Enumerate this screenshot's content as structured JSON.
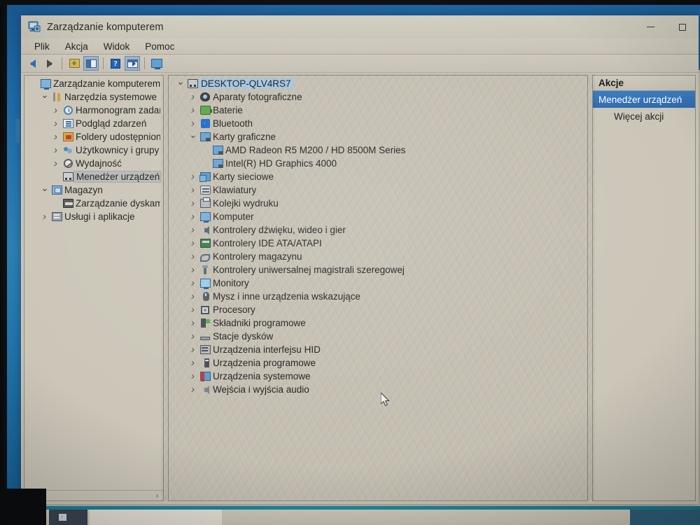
{
  "window": {
    "title": "Zarządzanie komputerem",
    "title_icon": "computer-management-icon",
    "controls": {
      "minimize": "minimize-icon",
      "maximize": "maximize-icon"
    }
  },
  "menubar": {
    "items": [
      {
        "label": "Plik"
      },
      {
        "label": "Akcja"
      },
      {
        "label": "Widok"
      },
      {
        "label": "Pomoc"
      }
    ]
  },
  "toolbar": {
    "buttons": [
      {
        "name": "back-arrow-icon"
      },
      {
        "name": "forward-arrow-icon"
      },
      {
        "name": "up-folder-icon"
      },
      {
        "name": "show-hide-console-tree-icon"
      },
      {
        "name": "help-icon"
      },
      {
        "name": "properties-icon"
      },
      {
        "name": "display-icon"
      }
    ]
  },
  "left_tree": {
    "nodes": [
      {
        "label": "Zarządzanie komputerem (loka",
        "indent": 0,
        "twisty": "none",
        "icon": "computer-icon",
        "state": "none"
      },
      {
        "label": "Narzędzia systemowe",
        "indent": 1,
        "twisty": "open",
        "icon": "system-tools-icon",
        "state": "none"
      },
      {
        "label": "Harmonogram zadań",
        "indent": 2,
        "twisty": "closed",
        "icon": "task-scheduler-icon",
        "state": "none"
      },
      {
        "label": "Podgląd zdarzeń",
        "indent": 2,
        "twisty": "closed",
        "icon": "event-viewer-icon",
        "state": "none"
      },
      {
        "label": "Foldery udostępnione",
        "indent": 2,
        "twisty": "closed",
        "icon": "shared-folders-icon",
        "state": "none"
      },
      {
        "label": "Użytkownicy i grupy lok",
        "indent": 2,
        "twisty": "closed",
        "icon": "users-groups-icon",
        "state": "none"
      },
      {
        "label": "Wydajność",
        "indent": 2,
        "twisty": "closed",
        "icon": "performance-icon",
        "state": "none"
      },
      {
        "label": "Menedżer urządzeń",
        "indent": 2,
        "twisty": "none",
        "icon": "device-manager-icon",
        "state": "selected-soft"
      },
      {
        "label": "Magazyn",
        "indent": 1,
        "twisty": "open",
        "icon": "storage-icon",
        "state": "none"
      },
      {
        "label": "Zarządzanie dyskami",
        "indent": 2,
        "twisty": "none",
        "icon": "disk-management-icon",
        "state": "none"
      },
      {
        "label": "Usługi i aplikacje",
        "indent": 1,
        "twisty": "closed",
        "icon": "services-applications-icon",
        "state": "none"
      }
    ],
    "hscroll": {
      "left_arrow": "‹",
      "right_arrow": "›"
    }
  },
  "device_tree": {
    "nodes": [
      {
        "label": "DESKTOP-QLV4RS7",
        "indent": 0,
        "twisty": "open",
        "icon": "computer-node-icon",
        "state": "selected-blue"
      },
      {
        "label": "Aparaty fotograficzne",
        "indent": 1,
        "twisty": "closed",
        "icon": "camera-icon",
        "state": "none"
      },
      {
        "label": "Baterie",
        "indent": 1,
        "twisty": "closed",
        "icon": "battery-icon",
        "state": "none"
      },
      {
        "label": "Bluetooth",
        "indent": 1,
        "twisty": "closed",
        "icon": "bluetooth-icon",
        "state": "none"
      },
      {
        "label": "Karty graficzne",
        "indent": 1,
        "twisty": "open",
        "icon": "display-adapter-icon",
        "state": "none"
      },
      {
        "label": "AMD Radeon R5 M200 / HD 8500M Series",
        "indent": 2,
        "twisty": "none",
        "icon": "display-adapter-icon",
        "state": "none"
      },
      {
        "label": "Intel(R) HD Graphics 4000",
        "indent": 2,
        "twisty": "none",
        "icon": "display-adapter-icon",
        "state": "none"
      },
      {
        "label": "Karty sieciowe",
        "indent": 1,
        "twisty": "closed",
        "icon": "network-adapter-icon",
        "state": "none"
      },
      {
        "label": "Klawiatury",
        "indent": 1,
        "twisty": "closed",
        "icon": "keyboard-icon",
        "state": "none"
      },
      {
        "label": "Kolejki wydruku",
        "indent": 1,
        "twisty": "closed",
        "icon": "print-queue-icon",
        "state": "none"
      },
      {
        "label": "Komputer",
        "indent": 1,
        "twisty": "closed",
        "icon": "computer-icon",
        "state": "none"
      },
      {
        "label": "Kontrolery dźwięku, wideo i gier",
        "indent": 1,
        "twisty": "closed",
        "icon": "sound-controller-icon",
        "state": "none"
      },
      {
        "label": "Kontrolery IDE ATA/ATAPI",
        "indent": 1,
        "twisty": "closed",
        "icon": "ide-controller-icon",
        "state": "none"
      },
      {
        "label": "Kontrolery magazynu",
        "indent": 1,
        "twisty": "closed",
        "icon": "storage-controller-icon",
        "state": "none"
      },
      {
        "label": "Kontrolery uniwersalnej magistrali szeregowej",
        "indent": 1,
        "twisty": "closed",
        "icon": "usb-controller-icon",
        "state": "none"
      },
      {
        "label": "Monitory",
        "indent": 1,
        "twisty": "closed",
        "icon": "monitor-icon",
        "state": "none"
      },
      {
        "label": "Mysz i inne urządzenia wskazujące",
        "indent": 1,
        "twisty": "closed",
        "icon": "mouse-icon",
        "state": "none"
      },
      {
        "label": "Procesory",
        "indent": 1,
        "twisty": "closed",
        "icon": "processor-icon",
        "state": "none"
      },
      {
        "label": "Składniki programowe",
        "indent": 1,
        "twisty": "closed",
        "icon": "software-components-icon",
        "state": "none"
      },
      {
        "label": "Stacje dysków",
        "indent": 1,
        "twisty": "closed",
        "icon": "disk-drive-icon",
        "state": "none"
      },
      {
        "label": "Urządzenia interfejsu HID",
        "indent": 1,
        "twisty": "closed",
        "icon": "hid-device-icon",
        "state": "none"
      },
      {
        "label": "Urządzenia programowe",
        "indent": 1,
        "twisty": "closed",
        "icon": "software-device-icon",
        "state": "none"
      },
      {
        "label": "Urządzenia systemowe",
        "indent": 1,
        "twisty": "closed",
        "icon": "system-device-icon",
        "state": "none"
      },
      {
        "label": "Wejścia i wyjścia audio",
        "indent": 1,
        "twisty": "closed",
        "icon": "audio-io-icon",
        "state": "none"
      }
    ]
  },
  "actions_pane": {
    "header": "Akcje",
    "selected_item": "Menedżer urządzeń",
    "items": [
      {
        "label": "Więcej akcji"
      }
    ]
  },
  "colors": {
    "selection_blue": "#a9cdea",
    "action_selected_blue": "#3a7cc0",
    "window_chrome": "#c9c4b6",
    "desktop_blue": "#1f6ba8",
    "taskbar_accent": "#1e8aa0"
  }
}
